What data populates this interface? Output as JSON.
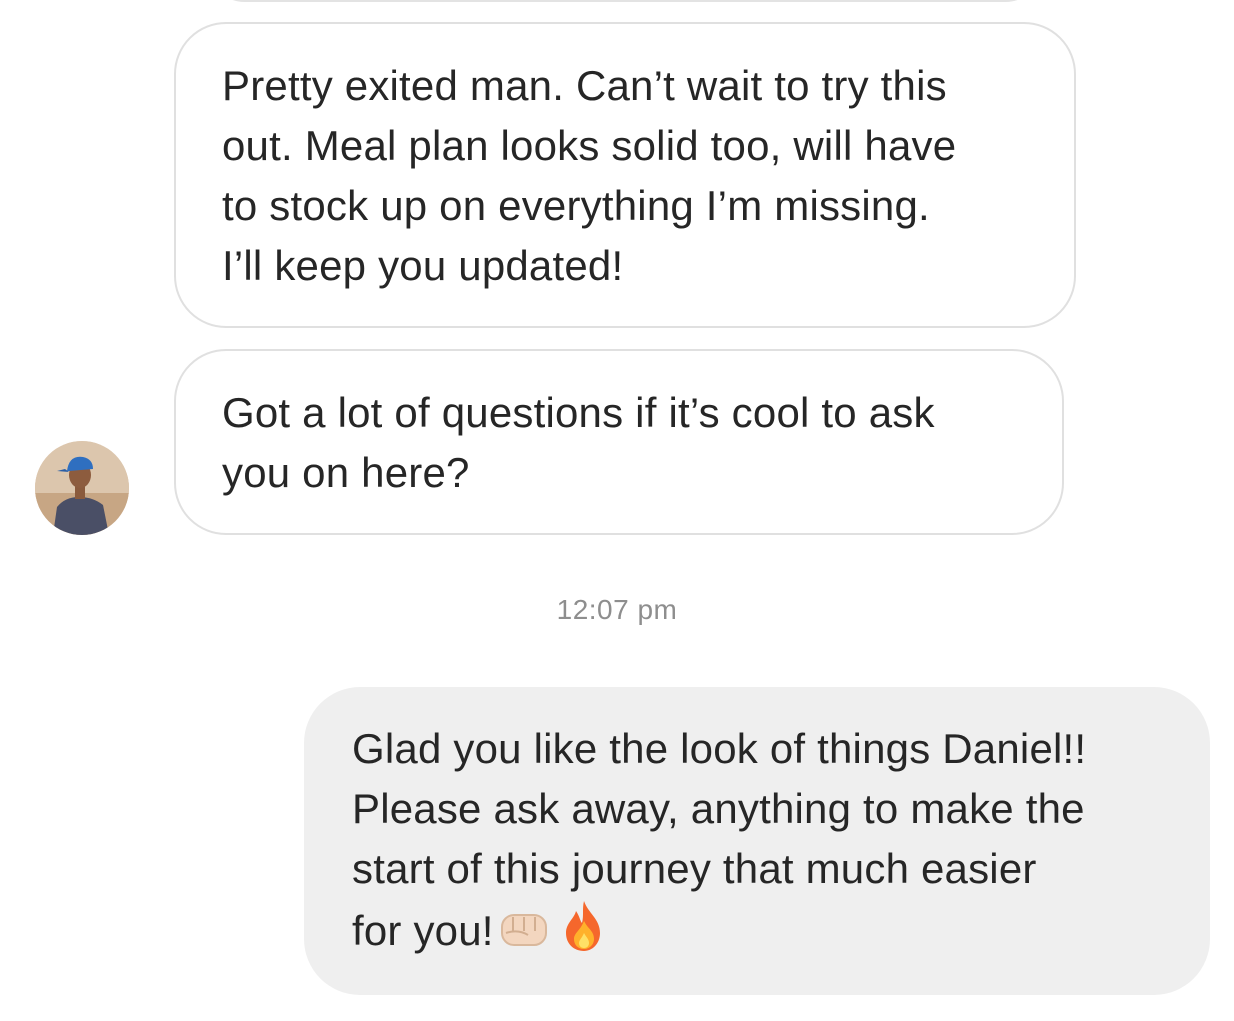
{
  "conversation": {
    "messages": [
      {
        "sender": "other",
        "lines": [
          "Pretty exited man. Can’t wait to try this",
          "out. Meal plan looks solid too, will have",
          "to stock up on everything I’m missing.",
          "I’ll keep you updated!"
        ]
      },
      {
        "sender": "other",
        "lines": [
          "Got a lot of questions if it’s cool to ask",
          "you on here?"
        ]
      },
      {
        "sender": "me",
        "lines": [
          "Glad you like the look of things Daniel!!",
          "Please ask away, anything to make the",
          "start of this journey that much easier",
          "for you!"
        ],
        "emoji": [
          "fist-bump-icon",
          "fire-icon"
        ]
      }
    ],
    "timestamp": "12:07 pm"
  },
  "colors": {
    "incoming_border": "#e0e0e0",
    "outgoing_bg": "#efefef",
    "text": "#262626",
    "timestamp": "#8e8e8e"
  }
}
